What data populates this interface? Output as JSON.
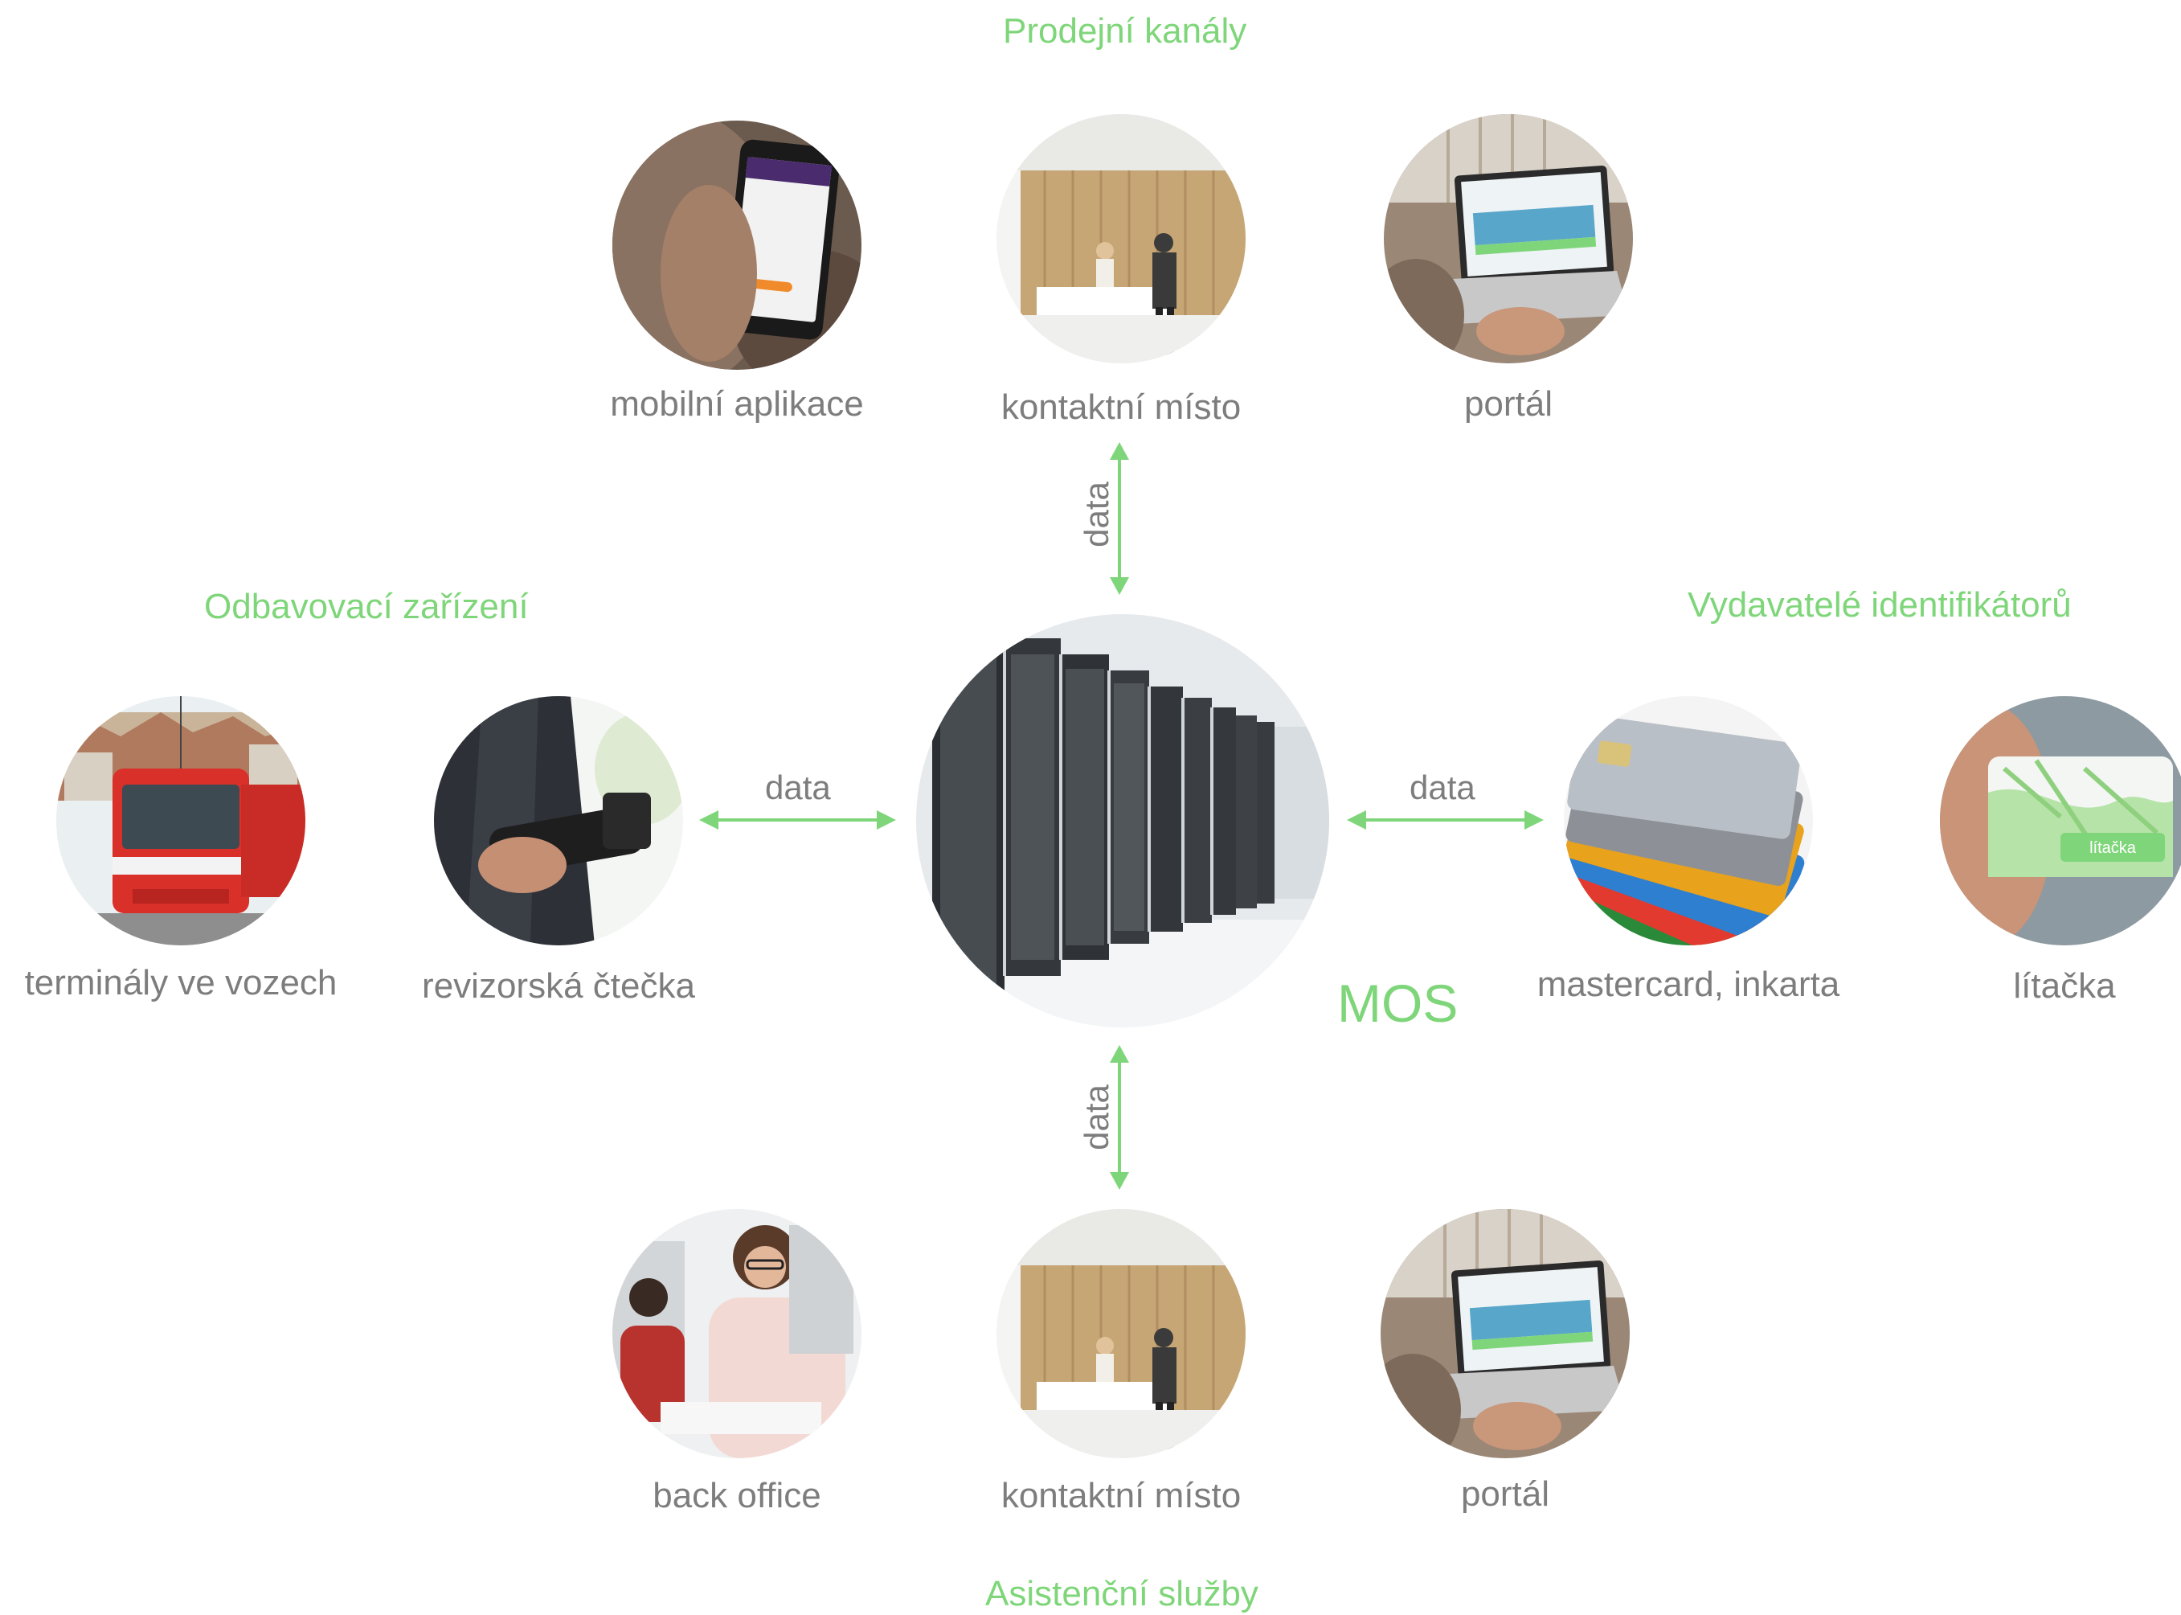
{
  "groups": {
    "sales": "Prodejní kanály",
    "validation": "Odbavovací zařízení",
    "issuers": "Vydavatelé identifikátorů",
    "assist": "Asistenční služby"
  },
  "center": {
    "label": "MOS"
  },
  "nodes": {
    "mobile_app": "mobilní aplikace",
    "contact_top": "kontaktní místo",
    "portal_top": "portál",
    "terminals": "terminály ve vozech",
    "reader": "revizorská čtečka",
    "cards": "mastercard, inkarta",
    "litacka": "lítačka",
    "back_office": "back office",
    "contact_bottom": "kontaktní místo",
    "portal_bottom": "portál"
  },
  "card_text": {
    "litacka_logo": "lítačka"
  },
  "edges": {
    "top": "data",
    "left": "data",
    "right": "data",
    "bottom": "data"
  },
  "colors": {
    "accent": "#7fd67a",
    "label": "#7d7d7d"
  }
}
